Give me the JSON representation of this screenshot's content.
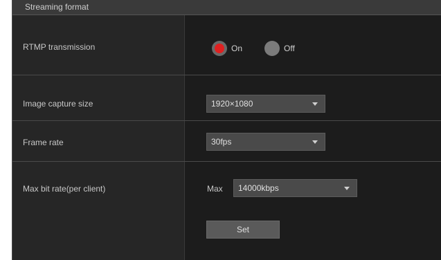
{
  "section": {
    "title": "Streaming format"
  },
  "rtmp": {
    "label": "RTMP transmission",
    "options": [
      {
        "label": "On",
        "selected": true
      },
      {
        "label": "Off",
        "selected": false
      }
    ]
  },
  "image_capture_size": {
    "label": "Image capture size",
    "value": "1920×1080"
  },
  "frame_rate": {
    "label": "Frame rate",
    "value": "30fps"
  },
  "max_bit_rate": {
    "label": "Max bit rate(per client)",
    "prefix": "Max",
    "value": "14000kbps"
  },
  "set_button": {
    "label": "Set"
  },
  "colors": {
    "radio_selected": "#e02020",
    "panel_bg": "#1c1c1c",
    "label_bg": "#262626"
  }
}
